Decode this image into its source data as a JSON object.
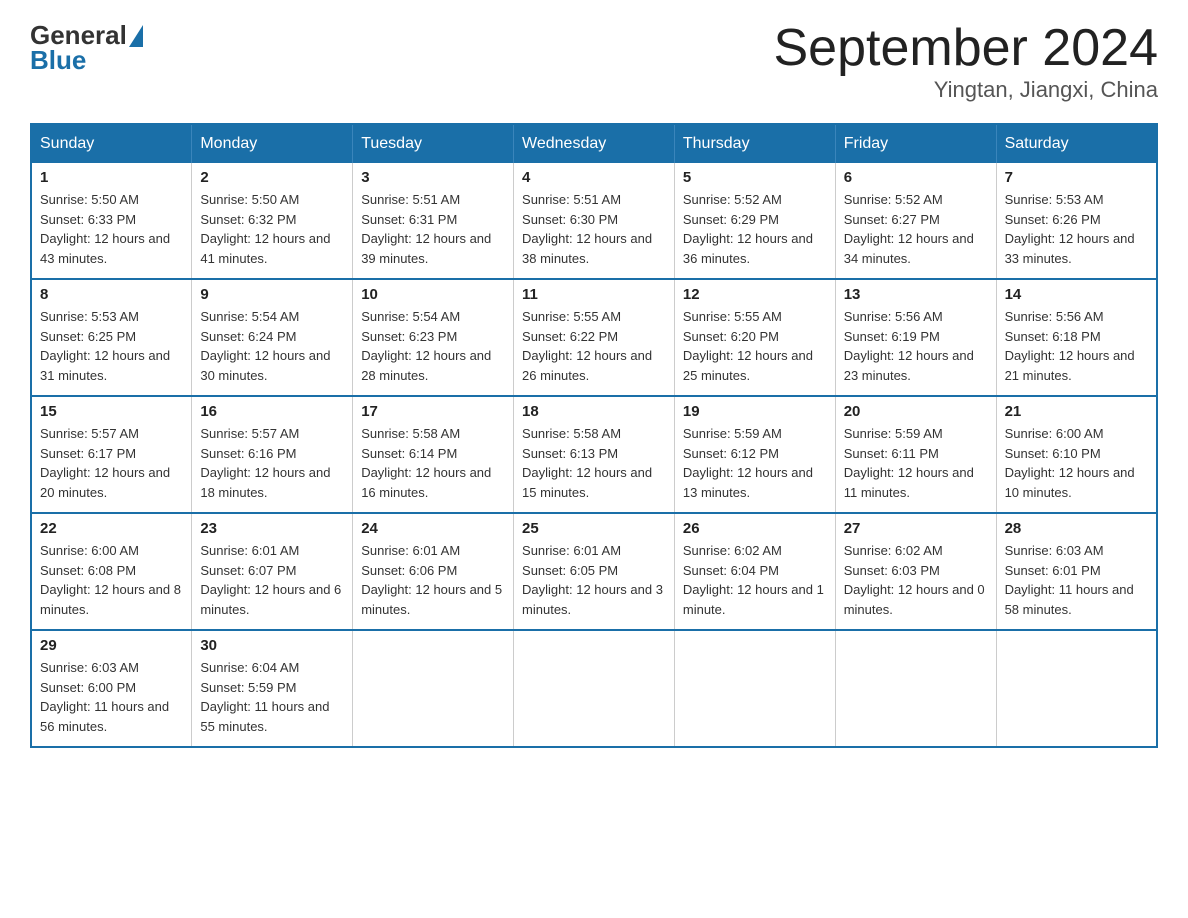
{
  "header": {
    "logo_text_general": "General",
    "logo_text_blue": "Blue",
    "month_title": "September 2024",
    "location": "Yingtan, Jiangxi, China"
  },
  "weekdays": [
    "Sunday",
    "Monday",
    "Tuesday",
    "Wednesday",
    "Thursday",
    "Friday",
    "Saturday"
  ],
  "weeks": [
    [
      {
        "day": "1",
        "sunrise": "5:50 AM",
        "sunset": "6:33 PM",
        "daylight": "12 hours and 43 minutes."
      },
      {
        "day": "2",
        "sunrise": "5:50 AM",
        "sunset": "6:32 PM",
        "daylight": "12 hours and 41 minutes."
      },
      {
        "day": "3",
        "sunrise": "5:51 AM",
        "sunset": "6:31 PM",
        "daylight": "12 hours and 39 minutes."
      },
      {
        "day": "4",
        "sunrise": "5:51 AM",
        "sunset": "6:30 PM",
        "daylight": "12 hours and 38 minutes."
      },
      {
        "day": "5",
        "sunrise": "5:52 AM",
        "sunset": "6:29 PM",
        "daylight": "12 hours and 36 minutes."
      },
      {
        "day": "6",
        "sunrise": "5:52 AM",
        "sunset": "6:27 PM",
        "daylight": "12 hours and 34 minutes."
      },
      {
        "day": "7",
        "sunrise": "5:53 AM",
        "sunset": "6:26 PM",
        "daylight": "12 hours and 33 minutes."
      }
    ],
    [
      {
        "day": "8",
        "sunrise": "5:53 AM",
        "sunset": "6:25 PM",
        "daylight": "12 hours and 31 minutes."
      },
      {
        "day": "9",
        "sunrise": "5:54 AM",
        "sunset": "6:24 PM",
        "daylight": "12 hours and 30 minutes."
      },
      {
        "day": "10",
        "sunrise": "5:54 AM",
        "sunset": "6:23 PM",
        "daylight": "12 hours and 28 minutes."
      },
      {
        "day": "11",
        "sunrise": "5:55 AM",
        "sunset": "6:22 PM",
        "daylight": "12 hours and 26 minutes."
      },
      {
        "day": "12",
        "sunrise": "5:55 AM",
        "sunset": "6:20 PM",
        "daylight": "12 hours and 25 minutes."
      },
      {
        "day": "13",
        "sunrise": "5:56 AM",
        "sunset": "6:19 PM",
        "daylight": "12 hours and 23 minutes."
      },
      {
        "day": "14",
        "sunrise": "5:56 AM",
        "sunset": "6:18 PM",
        "daylight": "12 hours and 21 minutes."
      }
    ],
    [
      {
        "day": "15",
        "sunrise": "5:57 AM",
        "sunset": "6:17 PM",
        "daylight": "12 hours and 20 minutes."
      },
      {
        "day": "16",
        "sunrise": "5:57 AM",
        "sunset": "6:16 PM",
        "daylight": "12 hours and 18 minutes."
      },
      {
        "day": "17",
        "sunrise": "5:58 AM",
        "sunset": "6:14 PM",
        "daylight": "12 hours and 16 minutes."
      },
      {
        "day": "18",
        "sunrise": "5:58 AM",
        "sunset": "6:13 PM",
        "daylight": "12 hours and 15 minutes."
      },
      {
        "day": "19",
        "sunrise": "5:59 AM",
        "sunset": "6:12 PM",
        "daylight": "12 hours and 13 minutes."
      },
      {
        "day": "20",
        "sunrise": "5:59 AM",
        "sunset": "6:11 PM",
        "daylight": "12 hours and 11 minutes."
      },
      {
        "day": "21",
        "sunrise": "6:00 AM",
        "sunset": "6:10 PM",
        "daylight": "12 hours and 10 minutes."
      }
    ],
    [
      {
        "day": "22",
        "sunrise": "6:00 AM",
        "sunset": "6:08 PM",
        "daylight": "12 hours and 8 minutes."
      },
      {
        "day": "23",
        "sunrise": "6:01 AM",
        "sunset": "6:07 PM",
        "daylight": "12 hours and 6 minutes."
      },
      {
        "day": "24",
        "sunrise": "6:01 AM",
        "sunset": "6:06 PM",
        "daylight": "12 hours and 5 minutes."
      },
      {
        "day": "25",
        "sunrise": "6:01 AM",
        "sunset": "6:05 PM",
        "daylight": "12 hours and 3 minutes."
      },
      {
        "day": "26",
        "sunrise": "6:02 AM",
        "sunset": "6:04 PM",
        "daylight": "12 hours and 1 minute."
      },
      {
        "day": "27",
        "sunrise": "6:02 AM",
        "sunset": "6:03 PM",
        "daylight": "12 hours and 0 minutes."
      },
      {
        "day": "28",
        "sunrise": "6:03 AM",
        "sunset": "6:01 PM",
        "daylight": "11 hours and 58 minutes."
      }
    ],
    [
      {
        "day": "29",
        "sunrise": "6:03 AM",
        "sunset": "6:00 PM",
        "daylight": "11 hours and 56 minutes."
      },
      {
        "day": "30",
        "sunrise": "6:04 AM",
        "sunset": "5:59 PM",
        "daylight": "11 hours and 55 minutes."
      },
      null,
      null,
      null,
      null,
      null
    ]
  ]
}
